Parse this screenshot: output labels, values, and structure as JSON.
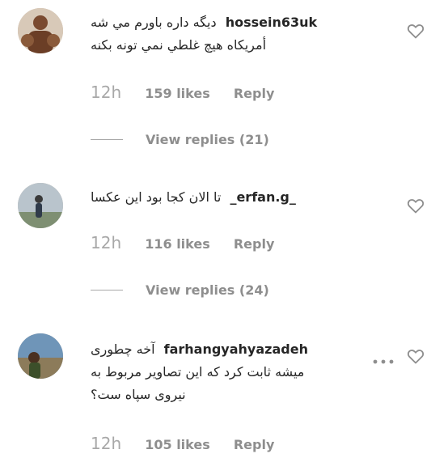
{
  "comments": [
    {
      "username": "hossein63uk",
      "text_line1": "ديگه داره باورم مي شه",
      "text_line2": "أمريكاه هيچ غلطي نمي تونه بكنه",
      "time": "12h",
      "likes": "159 likes",
      "reply": "Reply",
      "view_replies": "View replies (21)"
    },
    {
      "username": "_erfan.g_",
      "text_line1": "تا الان كجا بود اين عكسا",
      "time": "12h",
      "likes": "116 likes",
      "reply": "Reply",
      "view_replies": "View replies (24)"
    },
    {
      "username": "farhangyahyazadeh",
      "text_line1": "آخه چطوری",
      "text_line2": "ميشه ثابت كرد كه اين تصاوير مربوط به",
      "text_line3": "نيروی سپاه ست؟",
      "time": "12h",
      "likes": "105 likes",
      "reply": "Reply"
    }
  ],
  "icons": {
    "like": "heart-outline-icon",
    "more": "more-options-icon"
  },
  "colors": {
    "text": "#262626",
    "muted": "#8e8e8e",
    "background": "#ffffff"
  }
}
